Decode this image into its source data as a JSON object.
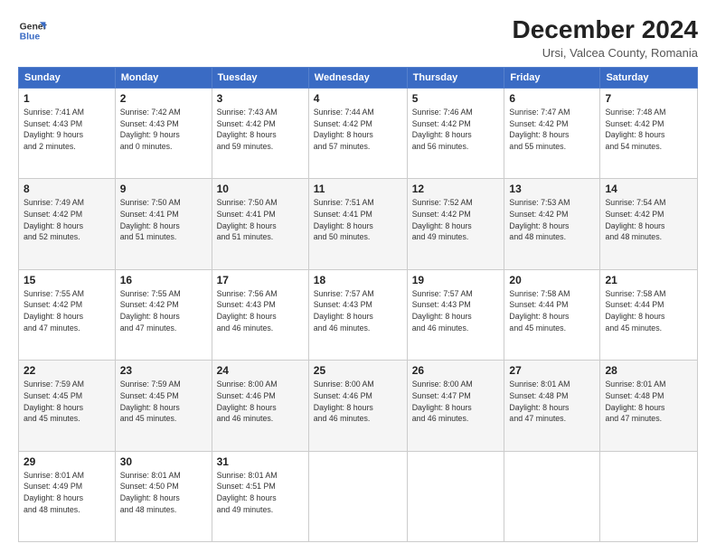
{
  "logo": {
    "line1": "General",
    "line2": "Blue"
  },
  "title": "December 2024",
  "subtitle": "Ursi, Valcea County, Romania",
  "header_days": [
    "Sunday",
    "Monday",
    "Tuesday",
    "Wednesday",
    "Thursday",
    "Friday",
    "Saturday"
  ],
  "weeks": [
    [
      {
        "day": "1",
        "info": "Sunrise: 7:41 AM\nSunset: 4:43 PM\nDaylight: 9 hours\nand 2 minutes."
      },
      {
        "day": "2",
        "info": "Sunrise: 7:42 AM\nSunset: 4:43 PM\nDaylight: 9 hours\nand 0 minutes."
      },
      {
        "day": "3",
        "info": "Sunrise: 7:43 AM\nSunset: 4:42 PM\nDaylight: 8 hours\nand 59 minutes."
      },
      {
        "day": "4",
        "info": "Sunrise: 7:44 AM\nSunset: 4:42 PM\nDaylight: 8 hours\nand 57 minutes."
      },
      {
        "day": "5",
        "info": "Sunrise: 7:46 AM\nSunset: 4:42 PM\nDaylight: 8 hours\nand 56 minutes."
      },
      {
        "day": "6",
        "info": "Sunrise: 7:47 AM\nSunset: 4:42 PM\nDaylight: 8 hours\nand 55 minutes."
      },
      {
        "day": "7",
        "info": "Sunrise: 7:48 AM\nSunset: 4:42 PM\nDaylight: 8 hours\nand 54 minutes."
      }
    ],
    [
      {
        "day": "8",
        "info": "Sunrise: 7:49 AM\nSunset: 4:42 PM\nDaylight: 8 hours\nand 52 minutes."
      },
      {
        "day": "9",
        "info": "Sunrise: 7:50 AM\nSunset: 4:41 PM\nDaylight: 8 hours\nand 51 minutes."
      },
      {
        "day": "10",
        "info": "Sunrise: 7:50 AM\nSunset: 4:41 PM\nDaylight: 8 hours\nand 51 minutes."
      },
      {
        "day": "11",
        "info": "Sunrise: 7:51 AM\nSunset: 4:41 PM\nDaylight: 8 hours\nand 50 minutes."
      },
      {
        "day": "12",
        "info": "Sunrise: 7:52 AM\nSunset: 4:42 PM\nDaylight: 8 hours\nand 49 minutes."
      },
      {
        "day": "13",
        "info": "Sunrise: 7:53 AM\nSunset: 4:42 PM\nDaylight: 8 hours\nand 48 minutes."
      },
      {
        "day": "14",
        "info": "Sunrise: 7:54 AM\nSunset: 4:42 PM\nDaylight: 8 hours\nand 48 minutes."
      }
    ],
    [
      {
        "day": "15",
        "info": "Sunrise: 7:55 AM\nSunset: 4:42 PM\nDaylight: 8 hours\nand 47 minutes."
      },
      {
        "day": "16",
        "info": "Sunrise: 7:55 AM\nSunset: 4:42 PM\nDaylight: 8 hours\nand 47 minutes."
      },
      {
        "day": "17",
        "info": "Sunrise: 7:56 AM\nSunset: 4:43 PM\nDaylight: 8 hours\nand 46 minutes."
      },
      {
        "day": "18",
        "info": "Sunrise: 7:57 AM\nSunset: 4:43 PM\nDaylight: 8 hours\nand 46 minutes."
      },
      {
        "day": "19",
        "info": "Sunrise: 7:57 AM\nSunset: 4:43 PM\nDaylight: 8 hours\nand 46 minutes."
      },
      {
        "day": "20",
        "info": "Sunrise: 7:58 AM\nSunset: 4:44 PM\nDaylight: 8 hours\nand 45 minutes."
      },
      {
        "day": "21",
        "info": "Sunrise: 7:58 AM\nSunset: 4:44 PM\nDaylight: 8 hours\nand 45 minutes."
      }
    ],
    [
      {
        "day": "22",
        "info": "Sunrise: 7:59 AM\nSunset: 4:45 PM\nDaylight: 8 hours\nand 45 minutes."
      },
      {
        "day": "23",
        "info": "Sunrise: 7:59 AM\nSunset: 4:45 PM\nDaylight: 8 hours\nand 45 minutes."
      },
      {
        "day": "24",
        "info": "Sunrise: 8:00 AM\nSunset: 4:46 PM\nDaylight: 8 hours\nand 46 minutes."
      },
      {
        "day": "25",
        "info": "Sunrise: 8:00 AM\nSunset: 4:46 PM\nDaylight: 8 hours\nand 46 minutes."
      },
      {
        "day": "26",
        "info": "Sunrise: 8:00 AM\nSunset: 4:47 PM\nDaylight: 8 hours\nand 46 minutes."
      },
      {
        "day": "27",
        "info": "Sunrise: 8:01 AM\nSunset: 4:48 PM\nDaylight: 8 hours\nand 47 minutes."
      },
      {
        "day": "28",
        "info": "Sunrise: 8:01 AM\nSunset: 4:48 PM\nDaylight: 8 hours\nand 47 minutes."
      }
    ],
    [
      {
        "day": "29",
        "info": "Sunrise: 8:01 AM\nSunset: 4:49 PM\nDaylight: 8 hours\nand 48 minutes."
      },
      {
        "day": "30",
        "info": "Sunrise: 8:01 AM\nSunset: 4:50 PM\nDaylight: 8 hours\nand 48 minutes."
      },
      {
        "day": "31",
        "info": "Sunrise: 8:01 AM\nSunset: 4:51 PM\nDaylight: 8 hours\nand 49 minutes."
      },
      null,
      null,
      null,
      null
    ]
  ]
}
